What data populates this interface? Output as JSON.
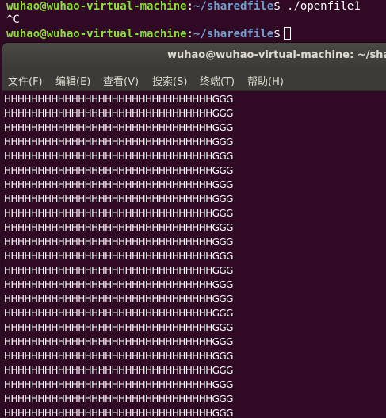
{
  "background_terminal": {
    "line1": {
      "prompt_user": "wuhao@wuhao-virtual-machine",
      "colon": ":",
      "path": "~/sharedfile",
      "suffix": "$ ./openfile1"
    },
    "line2": "^C",
    "line3": {
      "prompt_user": "wuhao@wuhao-virtual-machine",
      "colon": ":",
      "path": "~/sharedfile",
      "suffix": "$"
    }
  },
  "window": {
    "title": "wuhao@wuhao-virtual-machine: ~/shared",
    "menu": [
      "文件(F)",
      "编辑(E)",
      "查看(V)",
      "搜索(S)",
      "终端(T)",
      "帮助(H)"
    ]
  },
  "output": {
    "lines": [
      "HHHHHHHHHHHHHHHHHHHHHHHHHHHHHHHGGG",
      "HHHHHHHHHHHHHHHHHHHHHHHHHHHHHHHGGG",
      "HHHHHHHHHHHHHHHHHHHHHHHHHHHHHHHGGG",
      "HHHHHHHHHHHHHHHHHHHHHHHHHHHHHHHGGG",
      "HHHHHHHHHHHHHHHHHHHHHHHHHHHHHHHGGG",
      "HHHHHHHHHHHHHHHHHHHHHHHHHHHHHHHGGG",
      "HHHHHHHHHHHHHHHHHHHHHHHHHHHHHHHGGG",
      "HHHHHHHHHHHHHHHHHHHHHHHHHHHHHHHGGG",
      "HHHHHHHHHHHHHHHHHHHHHHHHHHHHHHHGGG",
      "HHHHHHHHHHHHHHHHHHHHHHHHHHHHHHHGGG",
      "HHHHHHHHHHHHHHHHHHHHHHHHHHHHHHHGGG",
      "HHHHHHHHHHHHHHHHHHHHHHHHHHHHHHHGGG",
      "HHHHHHHHHHHHHHHHHHHHHHHHHHHHHHHGGG",
      "HHHHHHHHHHHHHHHHHHHHHHHHHHHHHHHGGG",
      "HHHHHHHHHHHHHHHHHHHHHHHHHHHHHHHGGG",
      "HHHHHHHHHHHHHHHHHHHHHHHHHHHHHHHGGG",
      "HHHHHHHHHHHHHHHHHHHHHHHHHHHHHHHGGG",
      "HHHHHHHHHHHHHHHHHHHHHHHHHHHHHHHGGG",
      "HHHHHHHHHHHHHHHHHHHHHHHHHHHHHHHGGG",
      "HHHHHHHHHHHHHHHHHHHHHHHHHHHHHHHGGG",
      "HHHHHHHHHHHHHHHHHHHHHHHHHHHHHHHGGG",
      "HHHHHHHHHHHHHHHHHHHHHHHHHHHHHHHGGG",
      "HHHHHHHHHHHHHHHHHHHHHHHHHHHHHHHGGG"
    ]
  },
  "colors": {
    "terminal_bg": "#300a24",
    "prompt_user": "#8ae234",
    "prompt_path": "#729fcf",
    "text": "#ffffff",
    "titlebar": "#3c3b37",
    "titlebar_text": "#dfdbd2"
  }
}
